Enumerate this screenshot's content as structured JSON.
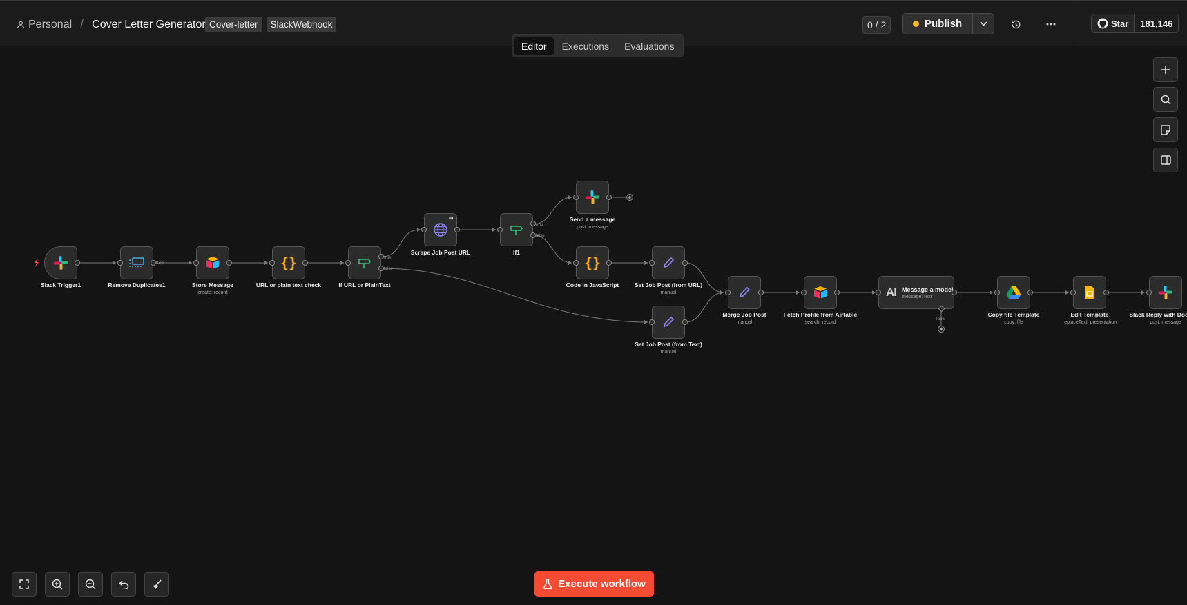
{
  "header": {
    "breadcrumb_root": "Personal",
    "workflow_title": "Cover Letter Generator",
    "tags": [
      "Cover-letter",
      "SlackWebhook"
    ],
    "counter": "0 / 2",
    "publish_label": "Publish",
    "publish_status_color": "#f5b731",
    "github_star_label": "Star",
    "github_star_count": "181,146"
  },
  "tabs": [
    {
      "label": "Editor",
      "active": true
    },
    {
      "label": "Executions",
      "active": false
    },
    {
      "label": "Evaluations",
      "active": false
    }
  ],
  "nodes": [
    {
      "id": "slack-trigger",
      "label": "Slack Trigger1",
      "sub": "",
      "icon": "slack-icon"
    },
    {
      "id": "remove-duplicates",
      "label": "Remove Duplicates1",
      "sub": "",
      "icon": "remove-duplicates-icon",
      "out_label": "Kept"
    },
    {
      "id": "store-message",
      "label": "Store Message",
      "sub": "create: record",
      "icon": "airtable-icon"
    },
    {
      "id": "url-check",
      "label": "URL or plain text check",
      "sub": "",
      "icon": "code-icon"
    },
    {
      "id": "if-url",
      "label": "If URL or PlainText",
      "sub": "",
      "icon": "if-icon",
      "out_true": "true",
      "out_false": "false"
    },
    {
      "id": "scrape",
      "label": "Scrape Job Post URL",
      "sub": "",
      "icon": "globe-icon"
    },
    {
      "id": "if1",
      "label": "If1",
      "sub": "",
      "icon": "if-icon",
      "out_true": "true",
      "out_false": "false"
    },
    {
      "id": "send-message",
      "label": "Send a message",
      "sub": "post: message",
      "icon": "slack-icon"
    },
    {
      "id": "code-js",
      "label": "Code in JavaScript",
      "sub": "",
      "icon": "code-icon"
    },
    {
      "id": "set-url",
      "label": "Set Job Post (from URL)",
      "sub": "manual",
      "icon": "pencil-icon"
    },
    {
      "id": "set-text",
      "label": "Set Job Post (from Text)",
      "sub": "manual",
      "icon": "pencil-icon"
    },
    {
      "id": "merge",
      "label": "Merge Job Post",
      "sub": "manual",
      "icon": "pencil-icon"
    },
    {
      "id": "fetch-profile",
      "label": "Fetch Profile from Airtable",
      "sub": "search: record",
      "icon": "airtable-icon"
    },
    {
      "id": "message-model",
      "label": "Message a model",
      "sub": "message: text",
      "icon": "anthropic-icon",
      "tools_label": "Tools"
    },
    {
      "id": "copy-template",
      "label": "Copy file Template",
      "sub": "copy: file",
      "icon": "google-drive-icon"
    },
    {
      "id": "edit-template",
      "label": "Edit Template",
      "sub": "replaceText: presentation",
      "icon": "google-slides-icon"
    },
    {
      "id": "slack-reply",
      "label": "Slack Reply with Doc Link",
      "sub": "post: message",
      "icon": "slack-icon"
    }
  ],
  "execute_label": "Execute workflow",
  "colors": {
    "accent": "#f44b32",
    "canvas_bg": "#141414",
    "node_bg": "#2b2b2b",
    "pencil": "#8f86f0",
    "code": "#f5a623",
    "if": "#2ec77d"
  }
}
